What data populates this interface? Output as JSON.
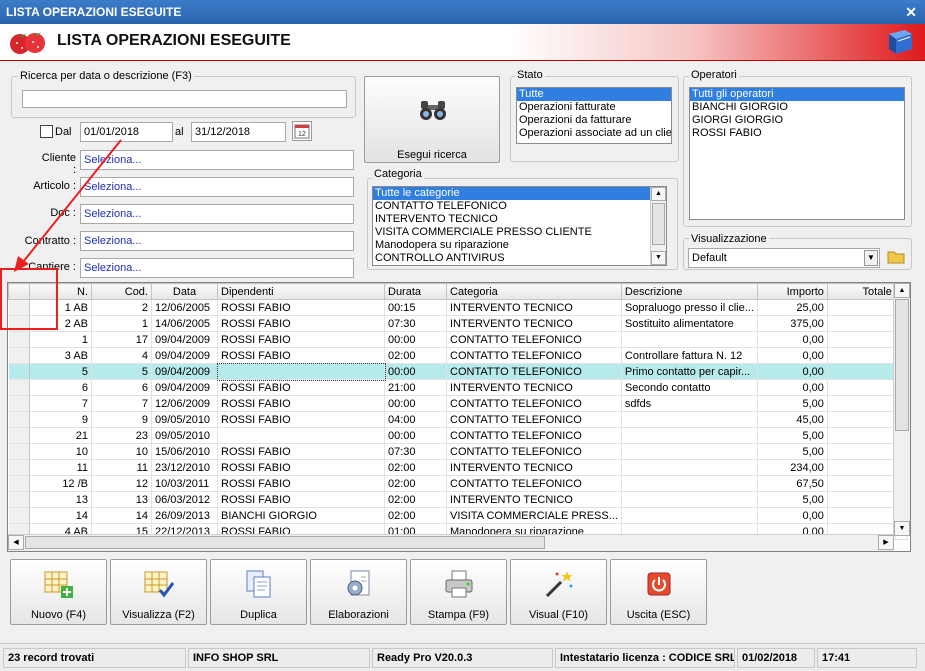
{
  "window": {
    "title": "LISTA OPERAZIONI ESEGUITE",
    "close_glyph": "✕"
  },
  "header": {
    "title": "LISTA OPERAZIONI ESEGUITE"
  },
  "search": {
    "group_label": "Ricerca per data o descrizione (F3)",
    "text_value": "",
    "dal_label": "Dal",
    "dal_checked": false,
    "date_from": "01/01/2018",
    "al_label": "al",
    "date_to": "31/12/2018",
    "fields": [
      {
        "label": "Cliente :",
        "value": "Seleziona..."
      },
      {
        "label": "Articolo :",
        "value": "Seleziona..."
      },
      {
        "label": "Doc :",
        "value": "Seleziona..."
      },
      {
        "label": "Contratto :",
        "value": "Seleziona..."
      },
      {
        "label": "Cantiere :",
        "value": "Seleziona..."
      }
    ],
    "search_button": "Esegui ricerca"
  },
  "stato": {
    "label": "Stato",
    "items": [
      "Tutte",
      "Operazioni fatturate",
      "Operazioni da fatturare",
      "Operazioni associate ad un cliente"
    ]
  },
  "operatori": {
    "label": "Operatori",
    "items": [
      "Tutti gli operatori",
      "BIANCHI GIORGIO",
      "GIORGI GIORGIO",
      "ROSSI FABIO"
    ]
  },
  "categoria": {
    "label": "Categoria",
    "items": [
      "Tutte le categorie",
      "CONTATTO TELEFONICO",
      "INTERVENTO TECNICO",
      "VISITA COMMERCIALE PRESSO CLIENTE",
      "Manodopera su riparazione",
      "CONTROLLO ANTIVIRUS"
    ]
  },
  "visualizzazione": {
    "label": "Visualizzazione",
    "value": "Default"
  },
  "table": {
    "columns": [
      "N.",
      "Cod.",
      "Data",
      "Dipendenti",
      "Durata",
      "Categoria",
      "Descrizione",
      "Importo",
      "Totale"
    ],
    "rows": [
      [
        "1 AB",
        "2",
        "12/06/2005",
        "ROSSI FABIO",
        "00:15",
        "INTERVENTO TECNICO",
        "Sopraluogo presso il clie...",
        "25,00",
        ""
      ],
      [
        "2 AB",
        "1",
        "14/06/2005",
        "ROSSI FABIO",
        "07:30",
        "INTERVENTO TECNICO",
        "Sostituito alimentatore",
        "375,00",
        ""
      ],
      [
        "1",
        "17",
        "09/04/2009",
        "ROSSI FABIO",
        "00:00",
        "CONTATTO TELEFONICO",
        "",
        "0,00",
        ""
      ],
      [
        "3 AB",
        "4",
        "09/04/2009",
        "ROSSI FABIO",
        "02:00",
        "CONTATTO TELEFONICO",
        "Controllare fattura N. 12",
        "0,00",
        ""
      ],
      [
        "5",
        "5",
        "09/04/2009",
        "",
        "00:00",
        "CONTATTO TELEFONICO",
        "Primo contatto per capir...",
        "0,00",
        ""
      ],
      [
        "6",
        "6",
        "09/04/2009",
        "ROSSI FABIO",
        "21:00",
        "INTERVENTO TECNICO",
        "Secondo contatto",
        "0,00",
        ""
      ],
      [
        "7",
        "7",
        "12/06/2009",
        "ROSSI FABIO",
        "00:00",
        "CONTATTO TELEFONICO",
        "sdfds",
        "5,00",
        ""
      ],
      [
        "9",
        "9",
        "09/05/2010",
        "ROSSI FABIO",
        "04:00",
        "CONTATTO TELEFONICO",
        "",
        "45,00",
        ""
      ],
      [
        "21",
        "23",
        "09/05/2010",
        "",
        "00:00",
        "CONTATTO TELEFONICO",
        "",
        "5,00",
        ""
      ],
      [
        "10",
        "10",
        "15/06/2010",
        "ROSSI FABIO",
        "07:30",
        "CONTATTO TELEFONICO",
        "",
        "5,00",
        ""
      ],
      [
        "11",
        "11",
        "23/12/2010",
        "ROSSI FABIO",
        "02:00",
        "INTERVENTO TECNICO",
        "",
        "234,00",
        ""
      ],
      [
        "12 /B",
        "12",
        "10/03/2011",
        "ROSSI FABIO",
        "02:00",
        "CONTATTO TELEFONICO",
        "",
        "67,50",
        ""
      ],
      [
        "13",
        "13",
        "06/03/2012",
        "ROSSI FABIO",
        "02:00",
        "INTERVENTO TECNICO",
        "",
        "5,00",
        ""
      ],
      [
        "14",
        "14",
        "26/09/2013",
        "BIANCHI GIORGIO",
        "02:00",
        "VISITA COMMERCIALE PRESS...",
        "",
        "0,00",
        ""
      ],
      [
        "4 AB",
        "15",
        "22/12/2013",
        "ROSSI FABIO",
        "01:00",
        "Manodopera su riparazione",
        "",
        "0,00",
        ""
      ]
    ]
  },
  "toolbar": {
    "buttons": [
      {
        "label": "Nuovo (F4)",
        "icon": "grid-add-icon"
      },
      {
        "label": "Visualizza (F2)",
        "icon": "grid-check-icon"
      },
      {
        "label": "Duplica",
        "icon": "duplicate-icon"
      },
      {
        "label": "Elaborazioni",
        "icon": "gear-document-icon"
      },
      {
        "label": "Stampa (F9)",
        "icon": "printer-icon"
      },
      {
        "label": "Visual (F10)",
        "icon": "magic-wand-icon"
      },
      {
        "label": "Uscita (ESC)",
        "icon": "power-icon"
      }
    ]
  },
  "status": {
    "records": "23 record trovati",
    "company": "INFO SHOP SRL",
    "version": "Ready Pro V20.0.3",
    "license": "Intestatario licenza : CODICE SRL",
    "date": "01/02/2018",
    "time": "17:41"
  },
  "colors": {
    "selection": "#2f7ee0",
    "highlight_row": "#b7eaea",
    "link_text": "#1f2fb3",
    "callout": "#e82020"
  }
}
